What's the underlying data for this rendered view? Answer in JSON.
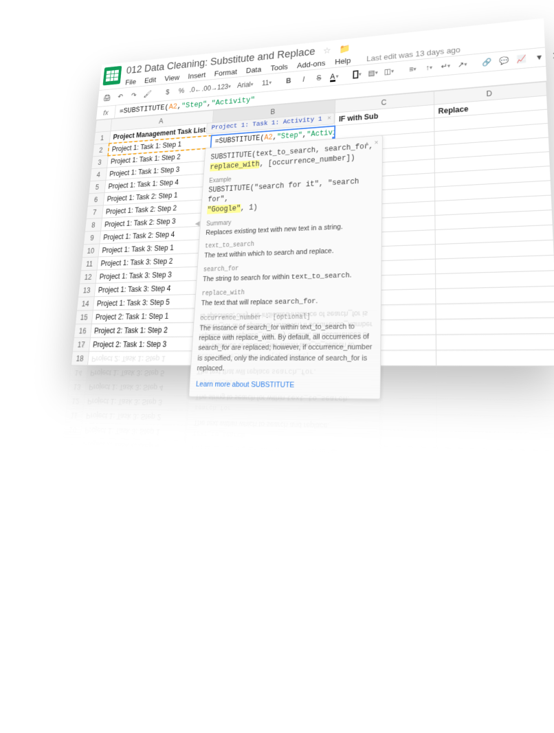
{
  "header": {
    "title": "012 Data Cleaning: Substitute and Replace",
    "menu": [
      "File",
      "Edit",
      "View",
      "Insert",
      "Format",
      "Data",
      "Tools",
      "Add-ons",
      "Help"
    ],
    "last_edit": "Last edit was 13 days ago"
  },
  "toolbar": {
    "currency": "$",
    "percent": "%",
    "dec_dec": ".0←",
    "dec_inc": ".00→",
    "numfmt": "123",
    "font": "Arial",
    "size": "11",
    "bold": "B",
    "italic": "I",
    "strike": "S",
    "textcolor": "A"
  },
  "fx": {
    "label": "fx",
    "fn": "=SUBSTITUTE(",
    "ref": "A2",
    "c1": ",",
    "s1": "\"Step\"",
    "c2": ",",
    "s2": "\"Activity\""
  },
  "columns": [
    "",
    "A",
    "B",
    "C",
    "D"
  ],
  "rows": [
    {
      "n": "1",
      "a_bold": true,
      "a": "Project Management Task List",
      "b": "",
      "c": "IF with Sub",
      "d": "Replace"
    },
    {
      "n": "2",
      "a": "Project 1: Task 1: Step 1",
      "b_formula": true
    },
    {
      "n": "3",
      "a": "Project 1: Task 1: Step 2"
    },
    {
      "n": "4",
      "a": "Project 1: Task 1: Step 3"
    },
    {
      "n": "5",
      "a": "Project 1: Task 1: Step 4"
    },
    {
      "n": "6",
      "a": "Project 1: Task 2: Step 1"
    },
    {
      "n": "7",
      "a": "Project 1: Task 2: Step 2"
    },
    {
      "n": "8",
      "a": "Project 1: Task 2: Step 3"
    },
    {
      "n": "9",
      "a": "Project 1: Task 2: Step 4"
    },
    {
      "n": "10",
      "a": "Project 1: Task 3: Step 1"
    },
    {
      "n": "11",
      "a": "Project 1: Task 3: Step 2"
    },
    {
      "n": "12",
      "a": "Project 1: Task 3: Step 3"
    },
    {
      "n": "13",
      "a": "Project 1: Task 3: Step 4"
    },
    {
      "n": "14",
      "a": "Project 1: Task 3: Step 5"
    },
    {
      "n": "15",
      "a": "Project 2: Task 1: Step 1"
    },
    {
      "n": "16",
      "a": "Project 2: Task 1: Step 2"
    },
    {
      "n": "17",
      "a": "Project 2: Task 1: Step 3"
    },
    {
      "n": "18",
      "a": ""
    }
  ],
  "preview": "Project 1: Task 1: Activity 1",
  "help": {
    "sig1": "SUBSTITUTE(text_to_search, search_for,",
    "sig2_hl": "replace_with",
    "sig2_rest": ", [occurrence_number])",
    "ex_label": "Example",
    "ex1": "SUBSTITUTE(\"search for it\", \"search for\",",
    "ex2_hl": "\"Google\"",
    "ex2_rest": ", 1)",
    "sum_label": "Summary",
    "sum_text": "Replaces existing text with new text in a string.",
    "p1_label": "text_to_search",
    "p1_text": "The text within which to search and replace.",
    "p2_label": "search_for",
    "p2_text_a": "The string to search for within ",
    "p2_text_code": "text_to_search",
    "p2_text_b": ".",
    "p3_label": "replace_with",
    "p3_text_a": "The text that will replace ",
    "p3_text_code": "search_for",
    "p3_text_b": ".",
    "p4_label": "occurrence_number - [optional]",
    "p4_text": "The instance of search_for within text_to_search to replace with replace_with. By default, all occurrences of search_for are replaced; however, if occurrence_number is specified, only the indicated instance of search_for is replaced.",
    "learn": "Learn more about SUBSTITUTE"
  }
}
